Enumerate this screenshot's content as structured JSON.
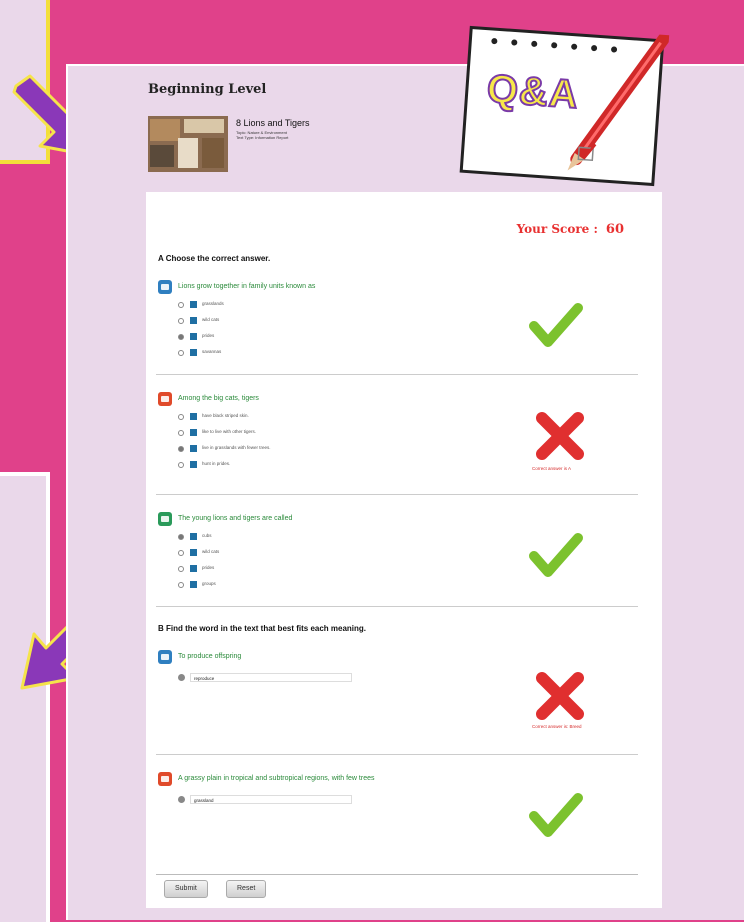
{
  "header": {
    "level_title": "Beginning Level",
    "book_title": "8 Lions and Tigers",
    "book_meta": "Topic: Nature & Environment\nText Type: Information Report"
  },
  "badge": {
    "label": "Q&A"
  },
  "score": {
    "label": "Your Score :",
    "value": "60"
  },
  "section_a": {
    "title": "A Choose the correct answer."
  },
  "questions": [
    {
      "text": "Lions grow together in family units known as",
      "options": [
        "grasslands",
        "wild cats",
        "prides",
        "savannas"
      ],
      "selected": 2,
      "result": "correct",
      "feedback": ""
    },
    {
      "text": "Among the big cats, tigers",
      "options": [
        "have black striped skin.",
        "like to live with other tigers.",
        "live in grasslands with fewer trees.",
        "hunt in prides."
      ],
      "selected": 2,
      "result": "wrong",
      "feedback": "Correct answer is A"
    },
    {
      "text": "The young lions and tigers are called",
      "options": [
        "cubs",
        "wild cats",
        "prides",
        "groups"
      ],
      "selected": 0,
      "result": "correct",
      "feedback": ""
    }
  ],
  "section_b": {
    "title": "B Find the word in the text that best fits each meaning."
  },
  "fill_questions": [
    {
      "text": "To produce offspring",
      "answer": "reproduce",
      "result": "wrong",
      "feedback": "Correct answer is: Breed"
    },
    {
      "text": "A grassy plain in tropical and subtropical regions, with few trees",
      "answer": "grassland",
      "result": "correct",
      "feedback": ""
    }
  ],
  "buttons": {
    "submit": "Submit",
    "reset": "Reset"
  },
  "colors": {
    "page_bg": "#e0418a",
    "panel_bg": "#ead8ea",
    "correct": "#7cc22e",
    "wrong": "#e02f2f",
    "score": "#e83030"
  }
}
